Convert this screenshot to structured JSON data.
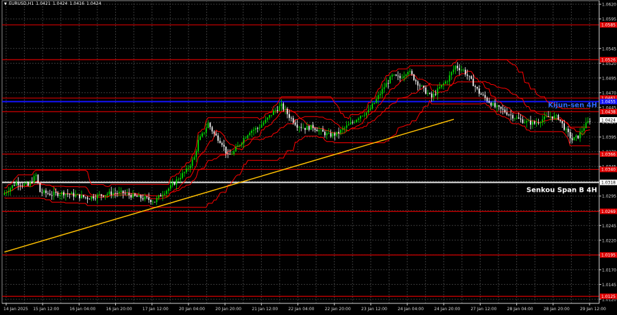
{
  "header": {
    "symbol": "EURUSD,H1",
    "open": "1.0421",
    "high": "1.0424",
    "low": "1.0416",
    "close": "1.0424"
  },
  "colors": {
    "background": "#000000",
    "grid": "#3c3c3c",
    "axis": "#d8d8d8",
    "bull_candle": "#00e000",
    "bear_candle": "#ffffff",
    "level_line": "#d40000",
    "ichimoku_line": "#ff0000",
    "kijun_line": "#1414ff",
    "senkou_line": "#e6e6e6",
    "trend_line": "#ffc000",
    "level_tag_bg": "#e00000",
    "price_tag_bg": "#1e1e1e",
    "blue_text": "#2d6bff"
  },
  "chart_data": {
    "type": "candlestick",
    "symbol": "EURUSD",
    "timeframe": "H1",
    "ylim": [
      1.0113,
      1.0626
    ],
    "y_ticks": [
      "1.0620",
      "1.0595",
      "1.0545",
      "1.0520",
      "1.0495",
      "1.0470",
      "1.0445",
      "1.0420",
      "1.0395",
      "1.0370",
      "1.0345",
      "1.0320",
      "1.0295",
      "1.0270",
      "1.0245",
      "1.0220",
      "1.0195",
      "1.0170",
      "1.0145",
      "1.0120"
    ],
    "x_ticks": [
      "14 Jan 2025",
      "15 Jan 12:00",
      "16 Jan 04:00",
      "16 Jan 20:00",
      "17 Jan 12:00",
      "20 Jan 04:00",
      "20 Jan 20:00",
      "21 Jan 12:00",
      "22 Jan 04:00",
      "22 Jan 20:00",
      "23 Jan 12:00",
      "24 Jan 04:00",
      "24 Jan 20:00",
      "27 Jan 12:00",
      "28 Jan 04:00",
      "28 Jan 20:00",
      "29 Jan 12:00"
    ],
    "last_price": "1.0424",
    "horizontal_levels": [
      {
        "price": 1.0585,
        "label": "1.0585",
        "color": "#d40000"
      },
      {
        "price": 1.0526,
        "label": "1.0526",
        "color": "#d40000"
      },
      {
        "price": 1.0461,
        "label": "1.0461",
        "color": "#d40000"
      },
      {
        "price": 1.0438,
        "label": "1.0438",
        "color": "#d40000"
      },
      {
        "price": 1.0366,
        "label": "1.0366",
        "color": "#d40000"
      },
      {
        "price": 1.034,
        "label": "1.0340",
        "color": "#d40000"
      },
      {
        "price": 1.0269,
        "label": "1.0269",
        "color": "#d40000"
      },
      {
        "price": 1.0195,
        "label": "1.0195",
        "color": "#d40000"
      },
      {
        "price": 1.0125,
        "label": "1.0125",
        "color": "#d40000"
      }
    ],
    "kijun": {
      "name": "Kijun-sen 4H",
      "price": 1.0455,
      "label": "1.0455"
    },
    "senkou": {
      "name": "Senkou Span B 4H",
      "price": 1.0318,
      "label": "1.0318"
    },
    "trend_line": [
      [
        0,
        1.02
      ],
      [
        159,
        1.0425
      ]
    ],
    "close_path": [
      [
        0,
        1.03
      ],
      [
        6,
        1.0318
      ],
      [
        12,
        1.0312
      ],
      [
        16,
        1.033
      ],
      [
        18,
        1.0302
      ],
      [
        24,
        1.0298
      ],
      [
        30,
        1.03
      ],
      [
        36,
        1.0296
      ],
      [
        42,
        1.0292
      ],
      [
        48,
        1.0296
      ],
      [
        54,
        1.03
      ],
      [
        60,
        1.03
      ],
      [
        66,
        1.0294
      ],
      [
        72,
        1.029
      ],
      [
        76,
        1.0286
      ],
      [
        80,
        1.03
      ],
      [
        84,
        1.031
      ],
      [
        88,
        1.0325
      ],
      [
        92,
        1.0338
      ],
      [
        96,
        1.036
      ],
      [
        98,
        1.0388
      ],
      [
        100,
        1.0398
      ],
      [
        103,
        1.0418
      ],
      [
        106,
        1.04
      ],
      [
        110,
        1.0385
      ],
      [
        113,
        1.0362
      ],
      [
        116,
        1.037
      ],
      [
        120,
        1.0388
      ],
      [
        124,
        1.0405
      ],
      [
        128,
        1.041
      ],
      [
        132,
        1.0422
      ],
      [
        136,
        1.0438
      ],
      [
        140,
        1.0448
      ],
      [
        144,
        1.043
      ],
      [
        148,
        1.0415
      ],
      [
        152,
        1.041
      ],
      [
        156,
        1.0412
      ],
      [
        160,
        1.0404
      ],
      [
        164,
        1.0398
      ],
      [
        168,
        1.04
      ],
      [
        172,
        1.041
      ],
      [
        176,
        1.042
      ],
      [
        180,
        1.0432
      ],
      [
        184,
        1.0438
      ],
      [
        188,
        1.0458
      ],
      [
        192,
        1.048
      ],
      [
        196,
        1.0498
      ],
      [
        200,
        1.0495
      ],
      [
        204,
        1.0508
      ],
      [
        208,
        1.049
      ],
      [
        212,
        1.0475
      ],
      [
        216,
        1.0462
      ],
      [
        220,
        1.0478
      ],
      [
        224,
        1.0492
      ],
      [
        228,
        1.0515
      ],
      [
        232,
        1.0508
      ],
      [
        236,
        1.049
      ],
      [
        240,
        1.047
      ],
      [
        244,
        1.0458
      ],
      [
        248,
        1.0446
      ],
      [
        252,
        1.044
      ],
      [
        256,
        1.0432
      ],
      [
        260,
        1.0425
      ],
      [
        264,
        1.042
      ],
      [
        268,
        1.0418
      ],
      [
        272,
        1.0425
      ],
      [
        276,
        1.043
      ],
      [
        280,
        1.0428
      ],
      [
        284,
        1.0405
      ],
      [
        287,
        1.039
      ],
      [
        290,
        1.0396
      ],
      [
        293,
        1.0412
      ],
      [
        296,
        1.0424
      ]
    ],
    "bars": 297,
    "num_series": 5
  }
}
